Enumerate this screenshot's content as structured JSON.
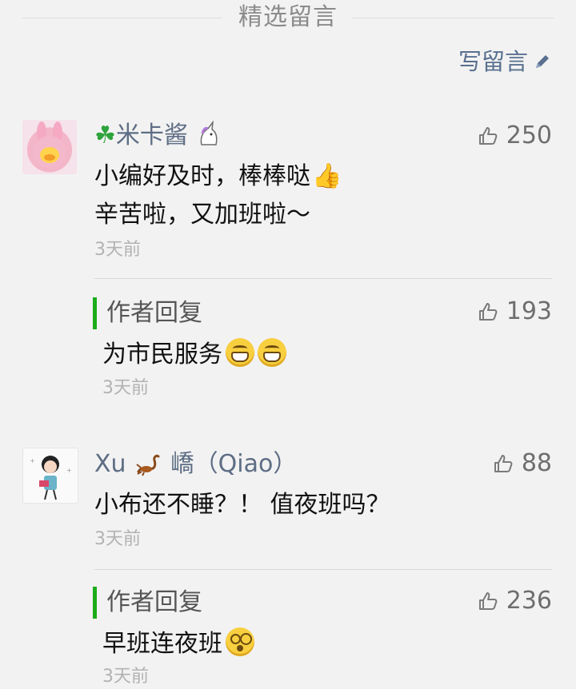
{
  "section": {
    "title": "精选留言"
  },
  "write_button": {
    "label": "写留言",
    "icon": "pencil-icon"
  },
  "comments": [
    {
      "nickname": "米卡酱",
      "nickname_prefix_icon": "four-leaf-clover-icon",
      "nickname_suffix_icon": "unicorn-icon",
      "likes": "250",
      "lines": [
        "小编好及时，棒棒哒",
        "辛苦啦，又加班啦～"
      ],
      "line1_emoji": "thumbs-up-icon",
      "time": "3天前",
      "reply": {
        "label": "作者回复",
        "likes": "193",
        "text": "为市民服务",
        "emoji": "grinning-face-icon",
        "time": "3天前"
      }
    },
    {
      "nickname_pre": "Xu",
      "nickname_icon": "scorpion-icon",
      "nickname_post": "嶠（Qiao）",
      "likes": "88",
      "lines": [
        "小布还不睡？！ 值夜班吗？"
      ],
      "time": "3天前",
      "reply": {
        "label": "作者回复",
        "likes": "236",
        "text": "早班连夜班",
        "emoji": "dizzy-face-icon",
        "time": "3天前"
      }
    }
  ]
}
